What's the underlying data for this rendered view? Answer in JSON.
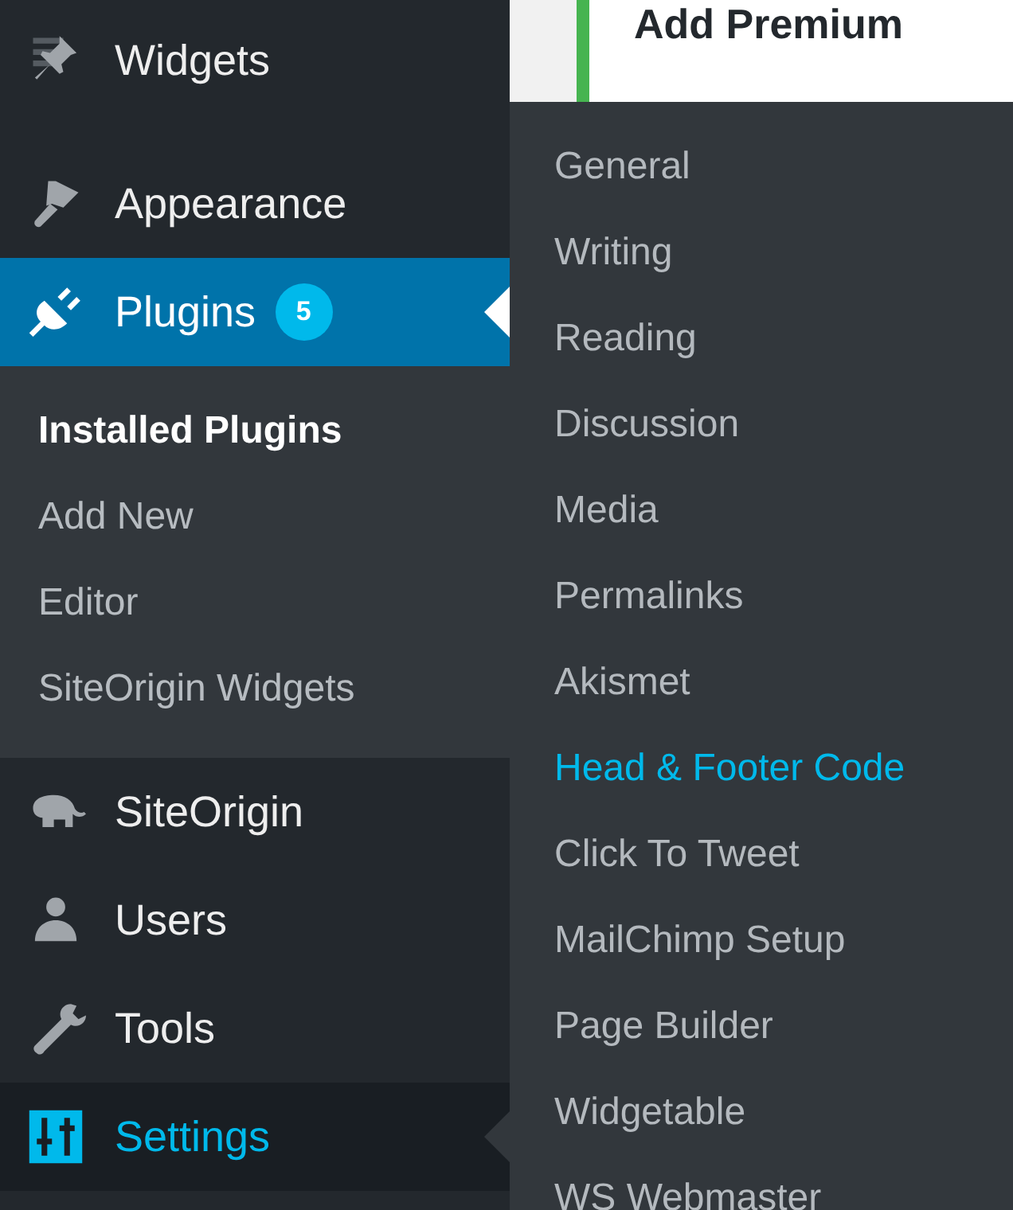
{
  "page": {
    "heading": "Add Premium"
  },
  "sidebar": {
    "items": [
      {
        "label": "Widgets",
        "selected": false,
        "hovered": false
      },
      {
        "label": "Appearance",
        "selected": false,
        "hovered": false
      },
      {
        "label": "Plugins",
        "selected": true,
        "hovered": false,
        "badge": "5",
        "submenu": [
          {
            "label": "Installed Plugins",
            "selected": true
          },
          {
            "label": "Add New",
            "selected": false
          },
          {
            "label": "Editor",
            "selected": false
          },
          {
            "label": "SiteOrigin Widgets",
            "selected": false
          }
        ]
      },
      {
        "label": "SiteOrigin",
        "selected": false,
        "hovered": false
      },
      {
        "label": "Users",
        "selected": false,
        "hovered": false
      },
      {
        "label": "Tools",
        "selected": false,
        "hovered": false
      },
      {
        "label": "Settings",
        "selected": false,
        "hovered": true
      }
    ]
  },
  "flyout": {
    "items": [
      {
        "label": "General",
        "highlighted": false
      },
      {
        "label": "Writing",
        "highlighted": false
      },
      {
        "label": "Reading",
        "highlighted": false
      },
      {
        "label": "Discussion",
        "highlighted": false
      },
      {
        "label": "Media",
        "highlighted": false
      },
      {
        "label": "Permalinks",
        "highlighted": false
      },
      {
        "label": "Akismet",
        "highlighted": false
      },
      {
        "label": "Head & Footer Code",
        "highlighted": true
      },
      {
        "label": "Click To Tweet",
        "highlighted": false
      },
      {
        "label": "MailChimp Setup",
        "highlighted": false
      },
      {
        "label": "Page Builder",
        "highlighted": false
      },
      {
        "label": "Widgetable",
        "highlighted": false
      },
      {
        "label": "WS Webmaster",
        "highlighted": false
      }
    ]
  }
}
